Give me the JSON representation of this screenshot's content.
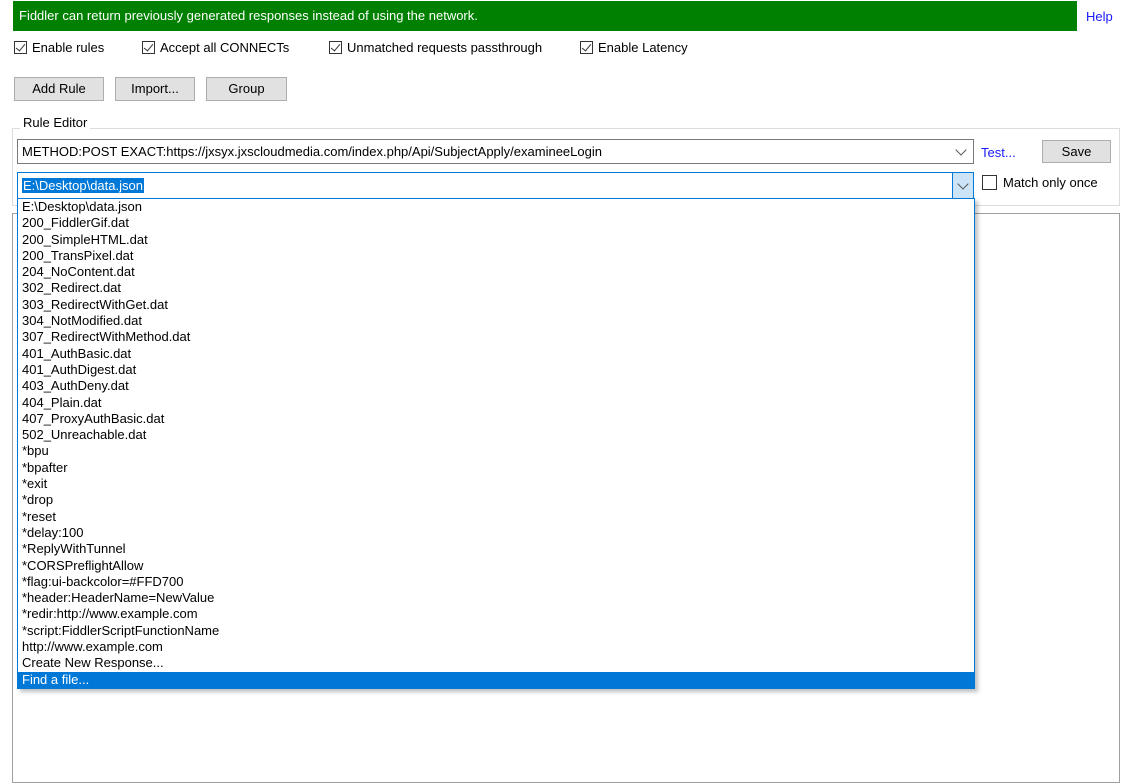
{
  "banner": {
    "text": "Fiddler can return previously generated responses instead of using the network.",
    "help": "Help"
  },
  "options": [
    {
      "label": "Enable rules",
      "checked": true
    },
    {
      "label": "Accept all CONNECTs",
      "checked": true
    },
    {
      "label": "Unmatched requests passthrough",
      "checked": true
    },
    {
      "label": "Enable Latency",
      "checked": true
    }
  ],
  "buttons": {
    "add_rule": "Add Rule",
    "import": "Import...",
    "group": "Group"
  },
  "rule_editor": {
    "title": "Rule Editor",
    "match_value": "METHOD:POST EXACT:https://jxsyx.jxscloudmedia.com/index.php/Api/SubjectApply/examineeLogin",
    "test": "Test...",
    "save": "Save",
    "response_value": "E:\\Desktop\\data.json",
    "match_only_once": {
      "label": "Match only once",
      "checked": false
    }
  },
  "dropdown": {
    "selected_index": 29,
    "items": [
      "E:\\Desktop\\data.json",
      "200_FiddlerGif.dat",
      "200_SimpleHTML.dat",
      "200_TransPixel.dat",
      "204_NoContent.dat",
      "302_Redirect.dat",
      "303_RedirectWithGet.dat",
      "304_NotModified.dat",
      "307_RedirectWithMethod.dat",
      "401_AuthBasic.dat",
      "401_AuthDigest.dat",
      "403_AuthDeny.dat",
      "404_Plain.dat",
      "407_ProxyAuthBasic.dat",
      "502_Unreachable.dat",
      "*bpu",
      "*bpafter",
      "*exit",
      "*drop",
      "*reset",
      "*delay:100",
      "*ReplyWithTunnel",
      "*CORSPreflightAllow",
      "*flag:ui-backcolor=#FFD700",
      "*header:HeaderName=NewValue",
      "*redir:http://www.example.com",
      "*script:FiddlerScriptFunctionName",
      "http://www.example.com",
      "Create New Response...",
      "Find a file..."
    ]
  }
}
